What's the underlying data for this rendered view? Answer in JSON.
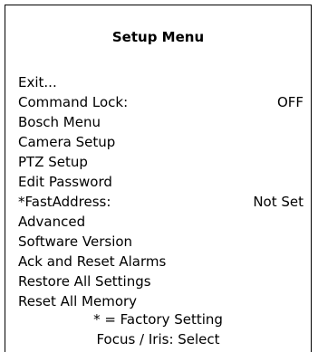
{
  "menu": {
    "title": "Setup Menu",
    "items": [
      {
        "label": "Exit...",
        "value": ""
      },
      {
        "label": "Command Lock:",
        "value": "OFF"
      },
      {
        "label": "Bosch Menu",
        "value": ""
      },
      {
        "label": "Camera Setup",
        "value": ""
      },
      {
        "label": "PTZ Setup",
        "value": ""
      },
      {
        "label": "Edit Password",
        "value": ""
      },
      {
        "label": "*FastAddress:",
        "value": "Not Set"
      },
      {
        "label": "Advanced",
        "value": ""
      },
      {
        "label": "Software Version",
        "value": ""
      },
      {
        "label": "Ack and Reset Alarms",
        "value": ""
      },
      {
        "label": "Restore All Settings",
        "value": ""
      },
      {
        "label": "Reset All Memory",
        "value": ""
      }
    ],
    "legend": "* = Factory Setting",
    "hint": "Focus / Iris: Select"
  }
}
